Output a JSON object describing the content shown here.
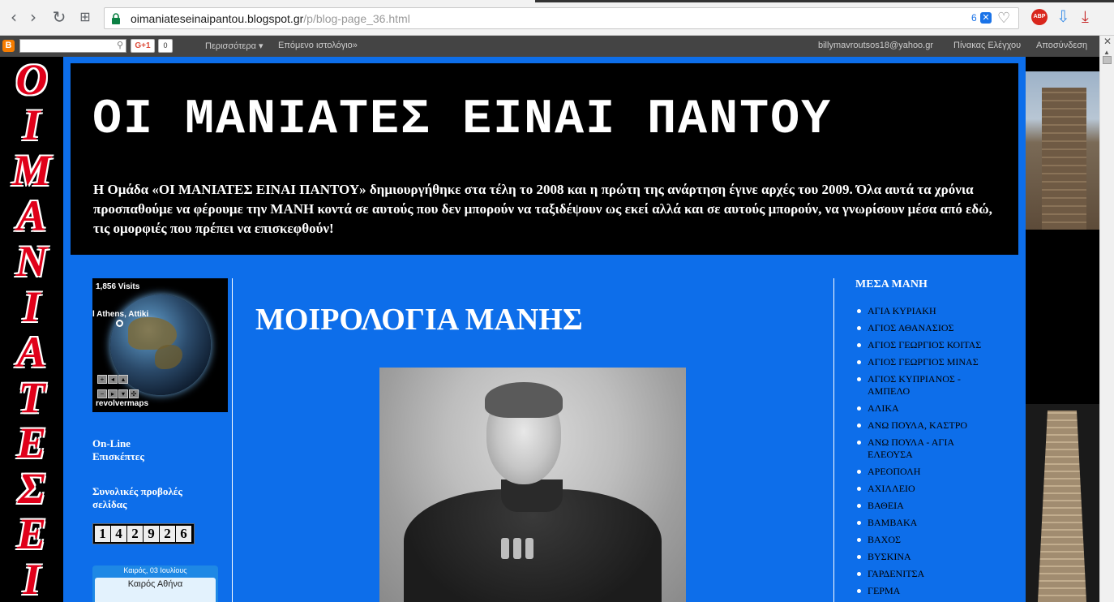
{
  "browser": {
    "url_domain": "oimaniateseinaipantou.blogspot.gr",
    "url_path": "/p/blog-page_36.html",
    "ext_badge_count": "6",
    "abp_label": "ABP"
  },
  "navbar": {
    "gplus_label": "G+1",
    "gplus_count": "0",
    "more_label": "Περισσότερα ▾",
    "next_blog_label": "Επόμενο ιστολόγιο»",
    "user_email": "billymavroutsos18@yahoo.gr",
    "dashboard_label": "Πίνακας Ελέγχου",
    "signout_label": "Αποσύνδεση"
  },
  "side_logo": [
    "O",
    "I",
    "M",
    "A",
    "N",
    "I",
    "A",
    "T",
    "E",
    "Σ",
    "E",
    "I"
  ],
  "header": {
    "title": "ΟΙ ΜΑΝΙΑΤΕΣ ΕΙΝΑΙ ΠΑΝΤΟΥ",
    "description": "Η Ομάδα «ΟΙ ΜΑΝΙΑΤΕΣ ΕΙΝΑΙ ΠΑΝΤΟΥ» δημιουργήθηκε στα τέλη το 2008 και η πρώτη της ανάρτηση έγινε αρχές του 2009. Όλα αυτά τα χρόνια προσπαθούμε να φέρουμε την ΜΑΝΗ κοντά σε αυτούς που δεν μπορούν να ταξιδέψουν ως εκεί αλλά και σε αυτούς μπορούν, να γνωρίσουν μέσα από εδώ, τις ομορφιές που πρέπει να επισκεφθούν!"
  },
  "left": {
    "visits": "1,856 Visits",
    "location": "l Athens, Attiki",
    "brand": "revolvermaps",
    "online_heading": "On-Line Επισκέπτες",
    "pageviews_heading": "Συνολικές προβολές σελίδας",
    "counter_digits": [
      "1",
      "4",
      "2",
      "9",
      "2",
      "6"
    ],
    "weather_date": "Καιρός, 03 Ιουλίους",
    "weather_city": "Καιρός Αθήνα"
  },
  "post": {
    "title": "ΜΟΙΡΟΛΟΓΙΑ ΜΑΝΗΣ"
  },
  "right": {
    "title": "ΜΕΣΑ ΜΑΝΗ",
    "items": [
      "ΑΓΙΑ ΚΥΡΙΑΚΗ",
      "ΑΓΙΟΣ ΑΘΑΝΑΣΙΟΣ",
      "ΑΓΙΟΣ ΓΕΩΡΓΙΟΣ ΚΟΙΤΑΣ",
      "ΑΓΙΟΣ ΓΕΩΡΓΙΟΣ ΜΙΝΑΣ",
      "ΑΓΙΟΣ ΚΥΠΡΙΑΝΟΣ - ΑΜΠΕΛΟ",
      "ΑΛΙΚΑ",
      "ΑΝΩ ΠΟΥΛΑ, ΚΑΣΤΡΟ",
      "ΑΝΩ ΠΟΥΛΑ - ΑΓΙΑ ΕΛΕΟΥΣΑ",
      "ΑΡΕΟΠΟΛΗ",
      "ΑΧΙΛΛΕΙΟ",
      "ΒΑΘΕΙΑ",
      "ΒΑΜΒΑΚΑ",
      "ΒΑΧΟΣ",
      "ΒΥΣΚΙΝΑ",
      "ΓΑΡΔΕΝΙΤΣΑ",
      "ΓΕΡΜΑ"
    ]
  },
  "colors": {
    "page_blue": "#0d6eea",
    "logo_red": "#e0001a"
  }
}
